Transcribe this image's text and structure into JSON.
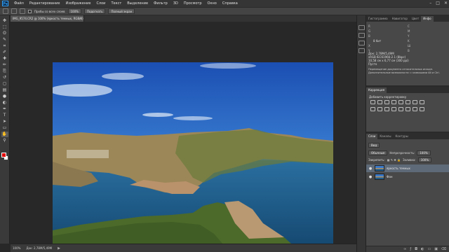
{
  "menu": {
    "logo": "Ps",
    "items": [
      "Файл",
      "Редактирование",
      "Изображение",
      "Слои",
      "Текст",
      "Выделение",
      "Фильтр",
      "3D",
      "Просмотр",
      "Окно",
      "Справка"
    ],
    "window_controls": [
      "–",
      "□",
      "✕"
    ]
  },
  "options": {
    "sample_all_label": "Пробы со всех слоев",
    "zoom_value": "100%",
    "fit_label": "Подогнать",
    "fill_label": "Полный экран"
  },
  "tools": [
    "move-icon",
    "marquee-icon",
    "lasso-icon",
    "quick-select-icon",
    "crop-icon",
    "eyedropper-icon",
    "healing-icon",
    "brush-icon",
    "stamp-icon",
    "history-brush-icon",
    "eraser-icon",
    "gradient-icon",
    "blur-icon",
    "dodge-icon",
    "pen-icon",
    "type-icon",
    "path-select-icon",
    "shape-icon",
    "hand-icon",
    "zoom-icon"
  ],
  "tool_glyphs": [
    "✥",
    "⬚",
    "ʘ",
    "✎",
    "⌗",
    "✐",
    "✚",
    "✏",
    "⎘",
    "↺",
    "◻",
    "▤",
    "●",
    "◐",
    "✒",
    "T",
    "➤",
    "▭",
    "✋",
    "⚲"
  ],
  "colors": {
    "foreground": "#e10000",
    "background": "#ffffff",
    "selection": "#5f6a78"
  },
  "document": {
    "tab_title": "IMG_9574.CR2 @ 100% (яркость темных, RGB/8)",
    "tab_close": "×"
  },
  "status": {
    "zoom": "100%",
    "doc_size": "Док: 2,78M/5,49M"
  },
  "panels": {
    "top_tabs": [
      "Гистограмма",
      "Навигатор",
      "Цвет",
      "Инфо"
    ],
    "active_top_tab": "Инфо",
    "info": {
      "rows": [
        [
          {
            "k": "R",
            "v": ""
          },
          {
            "k": "C",
            "v": ""
          }
        ],
        [
          {
            "k": "G",
            "v": ""
          },
          {
            "k": "M",
            "v": ""
          }
        ],
        [
          {
            "k": "B",
            "v": ""
          },
          {
            "k": "Y",
            "v": ""
          }
        ],
        [
          {
            "k": "",
            "v": "8 бит"
          },
          {
            "k": "K",
            "v": ""
          }
        ],
        [
          {
            "k": "X",
            "v": ""
          },
          {
            "k": "Ш",
            "v": ""
          }
        ],
        [
          {
            "k": "Y",
            "v": ""
          },
          {
            "k": "В",
            "v": ""
          }
        ]
      ],
      "doc_lines": [
        "Док: 2,78M/5,49M",
        "sRGB IEC61966-2.1 (8bpc)",
        "10,58 см x 6,77 см (300 ppi)",
        "Пусто"
      ],
      "hint": "Перемещение документа относительных исходн. Дополнительные возможности: с клавишами Alt и Ctrl."
    },
    "adjustments": {
      "tab": "Коррекция",
      "title": "Добавить корректировку",
      "icons": [
        "brightness-icon",
        "levels-icon",
        "curves-icon",
        "exposure-icon",
        "vibrance-icon",
        "hue-icon",
        "colorbalance-icon",
        "bw-icon",
        "photofilter-icon",
        "channelmixer-icon",
        "colorlookup-icon",
        "invert-icon",
        "posterize-icon",
        "threshold-icon",
        "gradientmap-icon",
        "selectivecolor-icon"
      ]
    },
    "layers": {
      "tabs": [
        "Слои",
        "Каналы",
        "Контуры"
      ],
      "active_tab": "Слои",
      "kind_filter": "Вид",
      "blend_mode": "Обычные",
      "opacity_label": "Непрозрачность:",
      "opacity_value": "100%",
      "lock_label": "Закрепить:",
      "fill_label": "Заливка:",
      "fill_value": "100%",
      "items": [
        {
          "name": "яркость темных",
          "selected": true
        },
        {
          "name": "Фон",
          "selected": false
        }
      ],
      "footer_icons": [
        "link-icon",
        "fx-icon",
        "mask-icon",
        "adjustment-layer-icon",
        "folder-icon",
        "new-layer-icon",
        "trash-icon"
      ]
    }
  }
}
